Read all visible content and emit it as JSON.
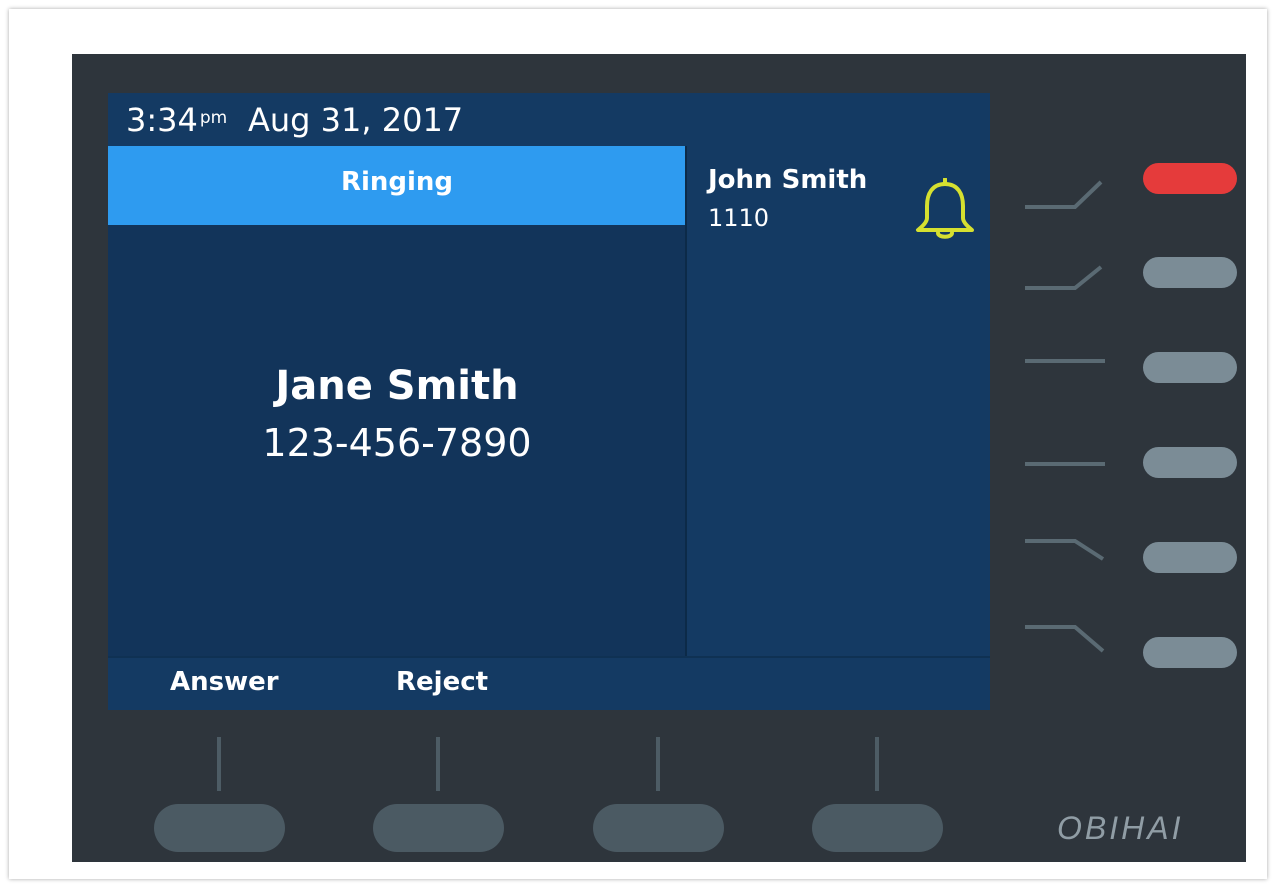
{
  "status_bar": {
    "time": "3:34",
    "ampm": "pm",
    "date": "Aug 31, 2017"
  },
  "call": {
    "state": "Ringing",
    "caller_name": "Jane Smith",
    "caller_number": "123-456-7890"
  },
  "line": {
    "name": "John Smith",
    "extension": "1110",
    "icon": "bell-icon",
    "icon_color": "#d6e030"
  },
  "softkeys": [
    {
      "label": "Answer"
    },
    {
      "label": "Reject"
    },
    {
      "label": ""
    },
    {
      "label": ""
    }
  ],
  "line_keys": [
    {
      "state": "active",
      "color": "#e53b3b"
    },
    {
      "state": "idle",
      "color": "#7b8c96"
    },
    {
      "state": "idle",
      "color": "#7b8c96"
    },
    {
      "state": "idle",
      "color": "#7b8c96"
    },
    {
      "state": "idle",
      "color": "#7b8c96"
    },
    {
      "state": "idle",
      "color": "#7b8c96"
    }
  ],
  "brand": "OBIHAI",
  "colors": {
    "header_highlight": "#2e9bf0",
    "screen_bg": "#12345a",
    "device_bg": "#2e353c"
  }
}
